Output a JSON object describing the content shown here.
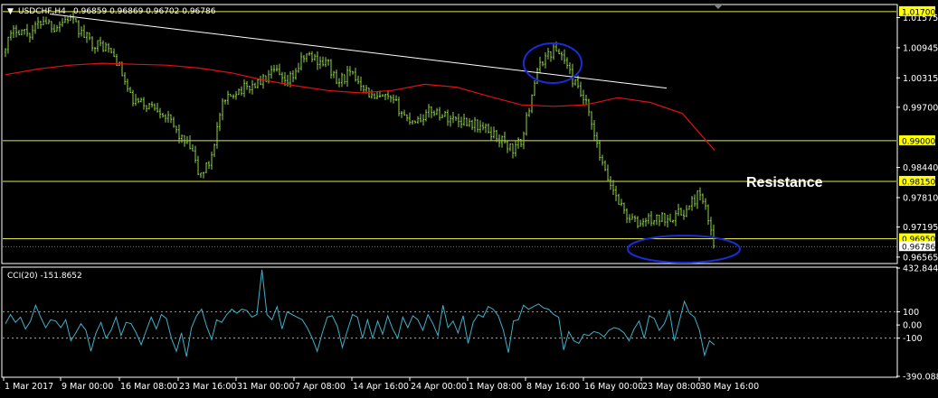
{
  "header": {
    "symbol": "USDCHF,H4",
    "ohlc": "0.96859 0.96869 0.96702 0.96786",
    "menu_glyph": "▼"
  },
  "annotation": {
    "resistance_label": "Resistance"
  },
  "colors": {
    "background": "#000000",
    "candle": "#8fd14a",
    "ma_line": "#e01010",
    "trendline": "#ffffff",
    "hline": "#e6e640",
    "highlight_circle": "#1a2cd6",
    "cci_line": "#40b0c8",
    "badge_fill": "#ffff00",
    "axis": "#ffffff"
  },
  "chart_data": [
    {
      "type": "candlestick",
      "title": "USDCHF,H4",
      "ylim": [
        0.9645,
        1.0183
      ],
      "y_ticks": [
        "1.01575",
        "1.00945",
        "1.00315",
        "0.99700",
        "0.98440",
        "0.97810",
        "0.97195",
        "0.96565"
      ],
      "x_ticks": [
        "1 Mar 2017",
        "9 Mar 00:00",
        "16 Mar 08:00",
        "23 Mar 16:00",
        "31 Mar 00:00",
        "7 Apr 08:00",
        "14 Apr 16:00",
        "24 Apr 00:00",
        "1 May 08:00",
        "8 May 16:00",
        "16 May 00:00",
        "23 May 08:00",
        "30 May 16:00"
      ],
      "price_path_x": [
        0,
        18,
        33,
        48,
        60,
        76,
        90,
        102,
        118,
        130,
        145,
        160,
        175,
        190,
        200,
        212,
        220,
        232,
        245,
        260,
        272,
        290,
        305,
        315,
        325,
        338,
        350,
        363,
        372,
        385,
        398,
        413,
        425,
        438,
        450,
        463,
        478,
        493,
        505,
        518,
        530,
        545,
        558,
        568,
        578,
        590,
        600,
        612,
        622,
        630,
        638,
        648,
        658,
        668,
        680,
        692,
        705,
        715,
        725,
        737,
        748,
        760,
        772,
        782,
        790
      ],
      "price_path": [
        1.0085,
        1.0135,
        1.0125,
        1.0155,
        1.0138,
        1.0158,
        1.0125,
        1.0105,
        1.0095,
        1.0065,
        0.9985,
        0.9975,
        0.997,
        0.9935,
        0.9905,
        0.988,
        0.9825,
        0.9855,
        0.997,
        1.0005,
        1.001,
        1.0025,
        1.0045,
        1.0015,
        1.004,
        1.008,
        1.007,
        1.006,
        1.002,
        1.004,
        1.0025,
        0.9985,
        0.999,
        0.9975,
        0.9945,
        0.9945,
        0.9965,
        0.995,
        0.9945,
        0.994,
        0.993,
        0.9915,
        0.9895,
        0.988,
        0.9905,
        1.002,
        1.007,
        1.009,
        1.008,
        1.004,
        1.001,
        0.9975,
        0.99,
        0.9835,
        0.979,
        0.9745,
        0.9725,
        0.9735,
        0.9735,
        0.974,
        0.9745,
        0.9755,
        0.979,
        0.9745,
        0.967
      ],
      "moving_average_path": [
        1.0038,
        1.005,
        1.0058,
        1.0062,
        1.006,
        1.0058,
        1.0052,
        1.0042,
        1.0027,
        1.0015,
        1.0005,
        1.0,
        1.0005,
        1.0018,
        1.0012,
        0.9993,
        0.9975,
        0.9972,
        0.9975,
        0.999,
        0.998,
        0.9957,
        0.988
      ],
      "horizontal_levels": [
        {
          "value": 1.017,
          "label": "1.01700"
        },
        {
          "value": 0.99,
          "label": "0.99000"
        },
        {
          "value": 0.9815,
          "label": "0.98150"
        },
        {
          "value": 0.9695,
          "label": "0.96950"
        },
        {
          "value": 0.96786,
          "label": "0.96786"
        }
      ],
      "trendline": {
        "from_value": 1.0165,
        "to_value": 1.001
      }
    },
    {
      "type": "line",
      "title": "CCI(20) -151.8652",
      "ylim": [
        -390.0885,
        432.8441
      ],
      "y_ticks": [
        "432.8441",
        "100",
        "0.00",
        "-100",
        "-390.0885"
      ],
      "reference_lines": [
        100,
        -100
      ],
      "values": [
        10,
        80,
        20,
        60,
        -30,
        30,
        150,
        60,
        -20,
        40,
        30,
        -20,
        40,
        -120,
        -60,
        10,
        -40,
        -200,
        -60,
        20,
        -100,
        -40,
        60,
        -80,
        20,
        10,
        -60,
        -150,
        -40,
        60,
        -30,
        80,
        50,
        -100,
        -200,
        -60,
        -240,
        -20,
        70,
        120,
        -10,
        -110,
        40,
        20,
        80,
        120,
        90,
        120,
        110,
        60,
        80,
        420,
        80,
        40,
        140,
        -30,
        100,
        80,
        60,
        40,
        -20,
        -100,
        -200,
        -60,
        60,
        70,
        -10,
        -170,
        -40,
        80,
        60,
        -100,
        40,
        -100,
        30,
        -70,
        70,
        -30,
        -100,
        60,
        -20,
        70,
        40,
        -40,
        80,
        10,
        -80,
        150,
        -20,
        30,
        -60,
        70,
        -140,
        20,
        80,
        60,
        140,
        120,
        70,
        -40,
        -210,
        30,
        40,
        150,
        120,
        140,
        160,
        130,
        120,
        80,
        60,
        -190,
        -50,
        -120,
        -140,
        -70,
        -80,
        -50,
        -60,
        -90,
        -40,
        -20,
        -30,
        -60,
        -120,
        -30,
        30,
        -100,
        70,
        50,
        -40,
        10,
        110,
        -120,
        30,
        180,
        90,
        60,
        -40,
        -230,
        -120,
        -152
      ]
    }
  ]
}
